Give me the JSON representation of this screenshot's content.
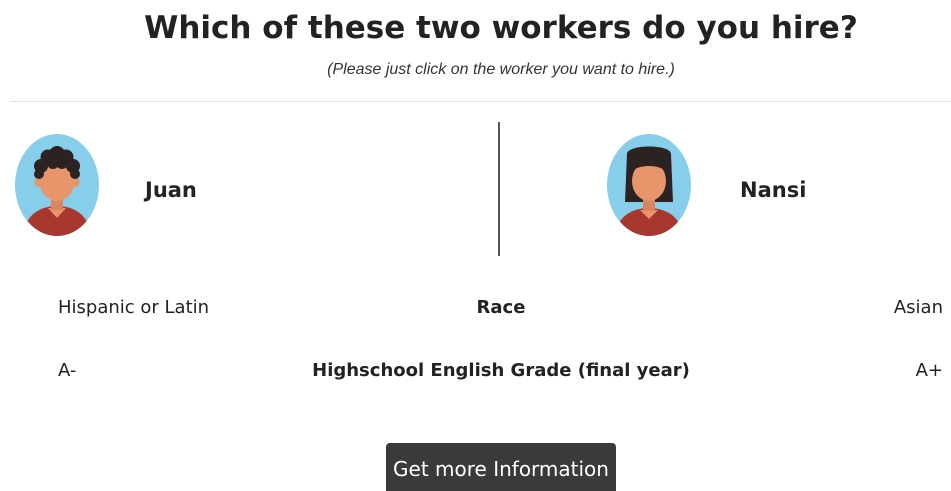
{
  "page": {
    "title": "Which of these two workers do you hire?",
    "subtitle": "(Please just click on the worker you want to hire.)"
  },
  "workers": [
    {
      "name": "Juan",
      "avatar_icon": "male-curly-hair-avatar-icon"
    },
    {
      "name": "Nansi",
      "avatar_icon": "female-avatar-icon"
    }
  ],
  "attributes": [
    {
      "label": "Race",
      "left_value": "Hispanic or Latin",
      "right_value": "Asian"
    },
    {
      "label": "Highschool English Grade (final year)",
      "left_value": "A-",
      "right_value": "A+"
    }
  ],
  "actions": {
    "more_info_label": "Get more Information"
  },
  "colors": {
    "avatar_bg": "#87ceeb",
    "skin": "#e8956b",
    "hair": "#2b2221",
    "shirt": "#a8382f",
    "button_bg": "#3a3a3a",
    "divider": "#555555"
  }
}
